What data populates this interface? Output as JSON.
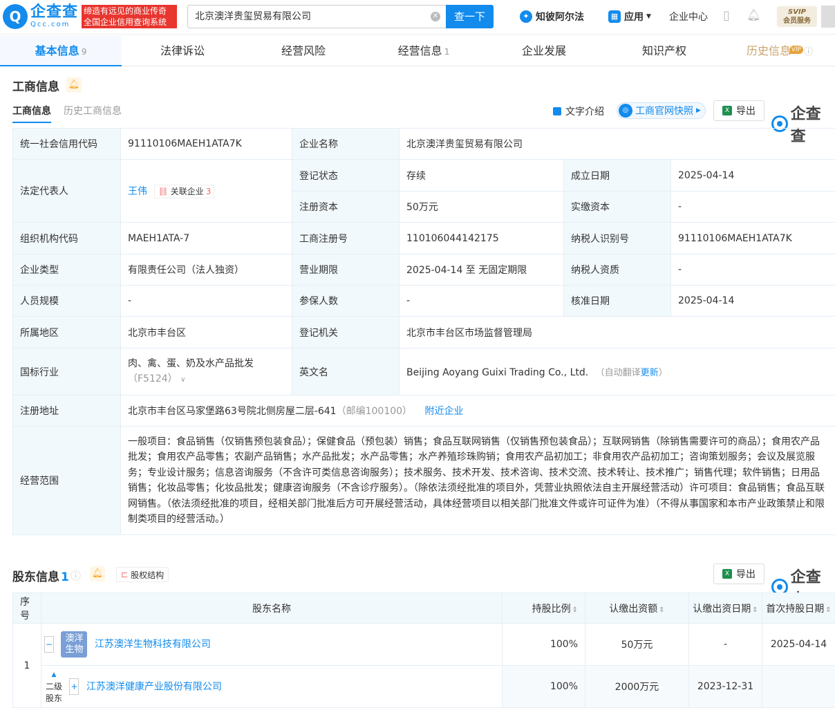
{
  "header": {
    "logo_cn": "企查查",
    "logo_en": "Qcc.com",
    "logo_mark": "Q",
    "slogan_line1": "缔造有远见的商业传奇",
    "slogan_line2": "全国企业信用查询系统",
    "search_value": "北京澳洋贵玺贸易有限公司",
    "search_button": "查一下",
    "zhibi": "知彼阿尔法",
    "app": "应用",
    "enterprise_center": "企业中心",
    "svip": "SVIP",
    "member_service": "会员服务"
  },
  "nav": {
    "tabs": [
      {
        "label": "基本信息",
        "count": "9"
      },
      {
        "label": "法律诉讼"
      },
      {
        "label": "经营风险"
      },
      {
        "label": "经营信息",
        "count": "1"
      },
      {
        "label": "企业发展"
      },
      {
        "label": "知识产权"
      },
      {
        "label": "历史信息",
        "badge": "VIP"
      }
    ]
  },
  "business": {
    "title": "工商信息",
    "subtabs": [
      "工商信息",
      "历史工商信息"
    ],
    "text_intro": "文字介绍",
    "snapshot": "工商官网快照",
    "export": "导出",
    "watermark": "企查查",
    "rows": {
      "credit_code_k": "统一社会信用代码",
      "credit_code_v": "91110106MAEH1ATA7K",
      "name_k": "企业名称",
      "name_v": "北京澳洋贵玺贸易有限公司",
      "legal_k": "法定代表人",
      "legal_v": "王伟",
      "legal_tag": "关联企业",
      "legal_tag_count": "3",
      "status_k": "登记状态",
      "status_v": "存续",
      "found_k": "成立日期",
      "found_v": "2025-04-14",
      "capital_k": "注册资本",
      "capital_v": "50万元",
      "paid_k": "实缴资本",
      "paid_v": "-",
      "org_k": "组织机构代码",
      "org_v": "MAEH1ATA-7",
      "reg_k": "工商注册号",
      "reg_v": "110106044142175",
      "tax_k": "纳税人识别号",
      "tax_v": "91110106MAEH1ATA7K",
      "type_k": "企业类型",
      "type_v": "有限责任公司（法人独资）",
      "term_k": "营业期限",
      "term_v": "2025-04-14 至 无固定期限",
      "taxq_k": "纳税人资质",
      "taxq_v": "-",
      "staff_k": "人员规模",
      "staff_v": "-",
      "insured_k": "参保人数",
      "insured_v": "-",
      "approve_k": "核准日期",
      "approve_v": "2025-04-14",
      "region_k": "所属地区",
      "region_v": "北京市丰台区",
      "authority_k": "登记机关",
      "authority_v": "北京市丰台区市场监督管理局",
      "industry_k": "国标行业",
      "industry_v": "肉、禽、蛋、奶及水产品批发",
      "industry_code": "（F5124）",
      "en_k": "英文名",
      "en_v": "Beijing Aoyang Guixi Trading Co., Ltd.",
      "en_note_prefix": "（自动翻译",
      "en_note_link": "更新",
      "en_note_suffix": "）",
      "addr_k": "注册地址",
      "addr_v": "北京市丰台区马家堡路63号院北侧房屋二层-641",
      "addr_zip": "（邮编100100）",
      "addr_nearby": "附近企业",
      "scope_k": "经营范围",
      "scope_v": "一般项目：食品销售（仅销售预包装食品）；保健食品（预包装）销售；食品互联网销售（仅销售预包装食品）；互联网销售（除销售需要许可的商品）；食用农产品批发；食用农产品零售；农副产品销售；水产品批发；水产品零售；水产养殖珍珠购销；食用农产品初加工；非食用农产品初加工；咨询策划服务；会议及展览服务；专业设计服务；信息咨询服务（不含许可类信息咨询服务）；技术服务、技术开发、技术咨询、技术交流、技术转让、技术推广；销售代理；软件销售；日用品销售；化妆品零售；化妆品批发；健康咨询服务（不含诊疗服务）。（除依法须经批准的项目外，凭营业执照依法自主开展经营活动）许可项目：食品销售；食品互联网销售。（依法须经批准的项目，经相关部门批准后方可开展经营活动，具体经营项目以相关部门批准文件或许可证件为准）（不得从事国家和本市产业政策禁止和限制类项目的经营活动。）"
    }
  },
  "shareholders": {
    "title": "股东信息",
    "count": "1",
    "equity_structure": "股权结构",
    "export": "导出",
    "watermark": "企查查",
    "columns": [
      "序号",
      "股东名称",
      "持股比例",
      "认缴出资额",
      "认缴出资日期",
      "首次持股日期"
    ],
    "rows": [
      {
        "no": "1",
        "logo_text": "澳洋生物",
        "name": "江苏澳洋生物科技有限公司",
        "ratio": "100%",
        "amount": "50万元",
        "date": "-",
        "first_date": "2025-04-14"
      }
    ],
    "second_level": {
      "label1": "二级",
      "label2": "股东",
      "name": "江苏澳洋健康产业股份有限公司",
      "ratio": "100%",
      "amount": "2000万元",
      "date": "2023-12-31"
    }
  }
}
